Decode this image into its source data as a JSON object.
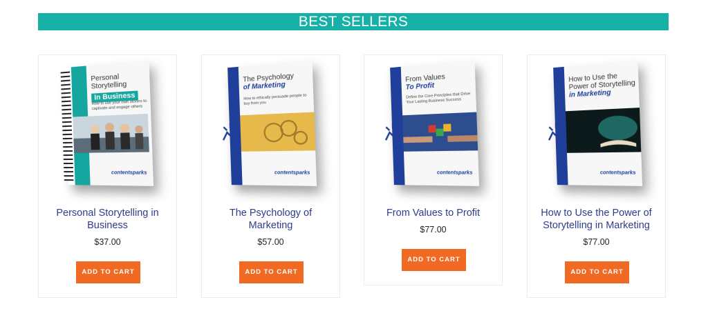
{
  "section": {
    "title": "BEST SELLERS"
  },
  "products": [
    {
      "title": "Personal Storytelling in Business",
      "price": "$37.00",
      "button": "ADD TO CART",
      "cover": {
        "title": "Personal Storytelling",
        "subtitle": "In Business",
        "tagline": "How to use your own stories to captivate and engage others",
        "brand": "contentsparks"
      }
    },
    {
      "title": "The Psychology of Marketing",
      "price": "$57.00",
      "button": "ADD TO CART",
      "cover": {
        "title": "The Psychology",
        "subtitle": "of Marketing",
        "tagline": "How to ethically persuade people to buy from you",
        "brand": "contentsparks"
      }
    },
    {
      "title": "From Values to Profit",
      "price": "$77.00",
      "button": "ADD TO CART",
      "cover": {
        "title": "From Values",
        "subtitle": "To Profit",
        "tagline": "Define the Core Principles that Drive Your Lasting Business Success",
        "brand": "contentsparks"
      }
    },
    {
      "title": "How to Use the Power of Storytelling in Marketing",
      "price": "$77.00",
      "button": "ADD TO CART",
      "cover": {
        "title": "How to Use the Power of Storytelling",
        "subtitle": "in Marketing",
        "tagline": "",
        "brand": "contentsparks"
      }
    }
  ],
  "colors": {
    "banner": "#17b0a6",
    "button": "#f16a23",
    "title": "#2f3b8c",
    "spine": "#1f3f9b"
  }
}
